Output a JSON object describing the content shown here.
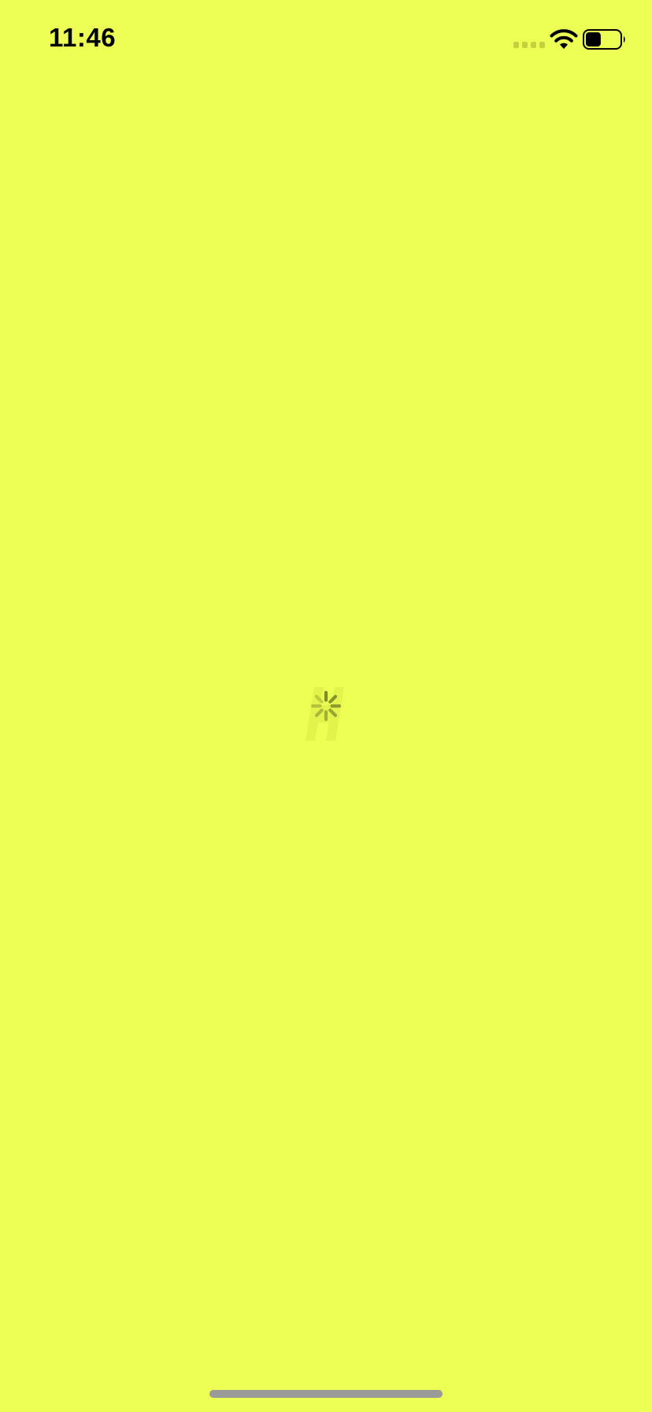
{
  "status_bar": {
    "time": "11:46",
    "icons": {
      "signal": "cellular-signal-icon",
      "wifi": "wifi-icon",
      "battery": "battery-icon"
    },
    "battery_level_fraction": 0.45
  },
  "loading": {
    "spinner": "activity-spinner-icon",
    "logo": "app-logo-watermark"
  },
  "colors": {
    "background": "#ecff55",
    "status_text": "#000000",
    "signal_dots": "#c1d23b",
    "spinner": "#7e8a2b",
    "logo_watermark": "#e2f44c",
    "home_indicator": "#9a9a98"
  },
  "home_indicator": {
    "icon": "home-indicator-bar"
  }
}
